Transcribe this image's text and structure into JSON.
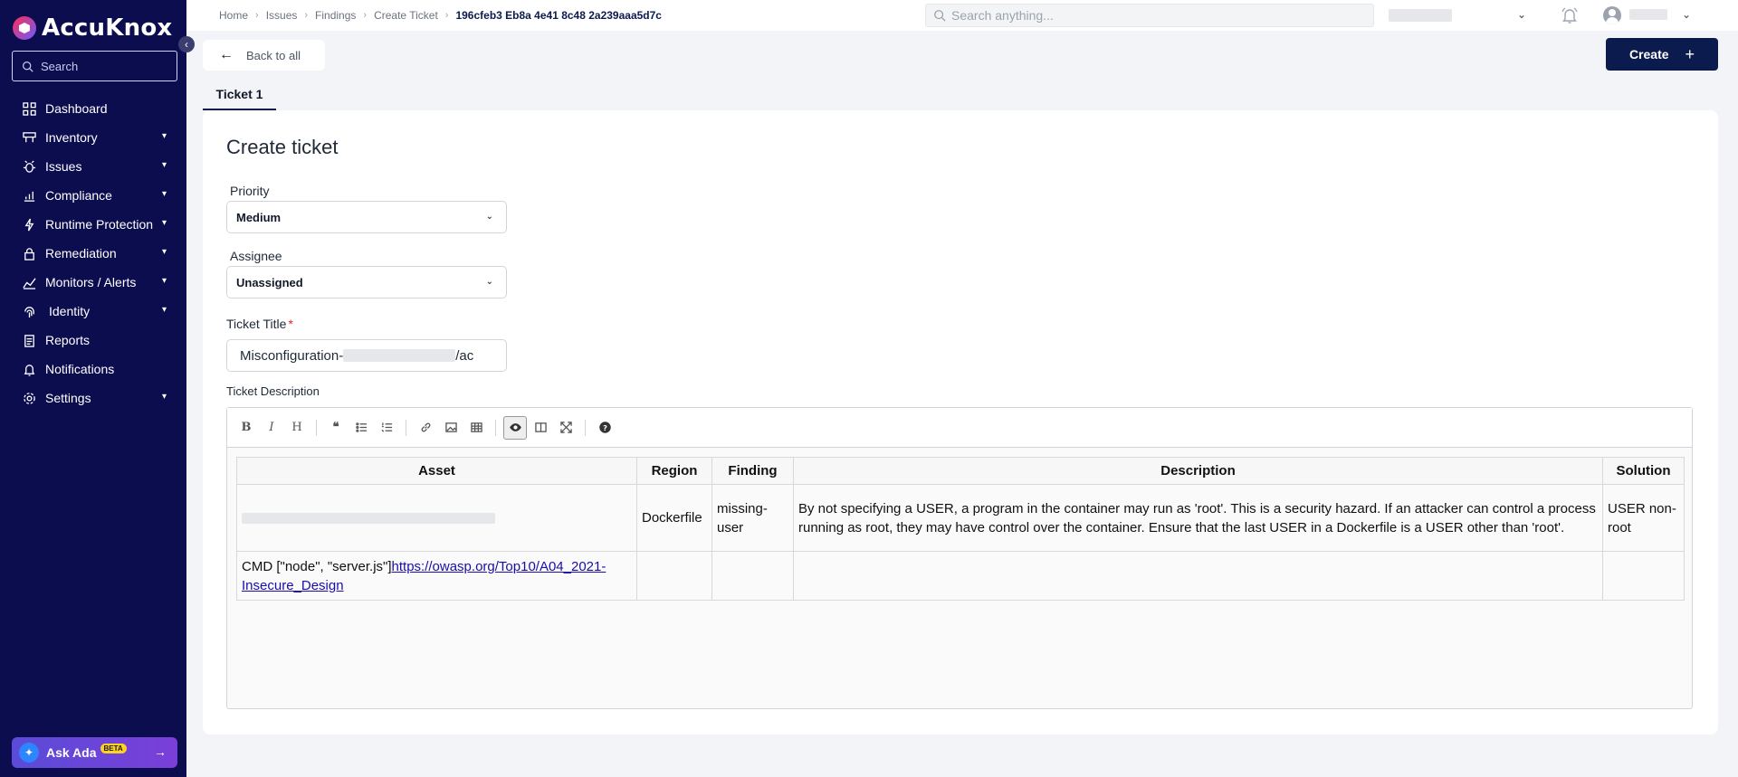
{
  "sidebar": {
    "logo": "AccuKnox",
    "search_placeholder": "Search",
    "items": [
      {
        "label": "Dashboard",
        "icon": "grid-icon",
        "expandable": false
      },
      {
        "label": "Inventory",
        "icon": "server-icon",
        "expandable": true
      },
      {
        "label": "Issues",
        "icon": "bug-icon",
        "expandable": true
      },
      {
        "label": "Compliance",
        "icon": "bar-chart-icon",
        "expandable": true
      },
      {
        "label": "Runtime Protection",
        "icon": "bolt-icon",
        "expandable": true
      },
      {
        "label": "Remediation",
        "icon": "lock-icon",
        "expandable": true
      },
      {
        "label": "Monitors / Alerts",
        "icon": "line-chart-icon",
        "expandable": true
      },
      {
        "label": "Identity",
        "icon": "fingerprint-icon",
        "expandable": true
      },
      {
        "label": "Reports",
        "icon": "clipboard-icon",
        "expandable": false
      },
      {
        "label": "Notifications",
        "icon": "bell-icon",
        "expandable": false
      },
      {
        "label": "Settings",
        "icon": "gear-icon",
        "expandable": true
      }
    ],
    "ask_ada": {
      "label": "Ask Ada",
      "badge": "BETA"
    }
  },
  "topbar": {
    "breadcrumb": [
      "Home",
      "Issues",
      "Findings",
      "Create Ticket",
      "196cfeb3 Eb8a 4e41 8c48 2a239aaa5d7c"
    ],
    "search_placeholder": "Search anything..."
  },
  "actions": {
    "back_label": "Back to all",
    "create_label": "Create"
  },
  "tabs": [
    {
      "label": "Ticket 1",
      "active": true
    }
  ],
  "form": {
    "title": "Create ticket",
    "priority": {
      "label": "Priority",
      "value": "Medium"
    },
    "assignee": {
      "label": "Assignee",
      "value": "Unassigned"
    },
    "ticket_title": {
      "label": "Ticket Title",
      "required": "*",
      "prefix": "Misconfiguration-",
      "suffix": "/ac"
    },
    "description_label": "Ticket Description"
  },
  "editor": {
    "toolbar": [
      "bold",
      "italic",
      "heading",
      "quote",
      "unordered-list",
      "ordered-list",
      "link",
      "image",
      "table",
      "preview",
      "side-by-side",
      "fullscreen",
      "guide"
    ],
    "table": {
      "headers": [
        "Asset",
        "Region",
        "Finding",
        "Description",
        "Solution"
      ],
      "rows": [
        {
          "asset": "",
          "region": "Dockerfile",
          "finding": "missing-user",
          "description": "By not specifying a USER, a program in the container may run as 'root'. This is a security hazard. If an attacker can control a process running as root, they may have control over the container. Ensure that the last USER in a Dockerfile is a USER other than 'root'.",
          "solution": "USER non-root"
        },
        {
          "asset_text": "CMD [\"node\", \"server.js\"]",
          "asset_link": "https://owasp.org/Top10/A04_2021-Insecure_Design",
          "region": "",
          "finding": "",
          "description": "",
          "solution": ""
        }
      ]
    }
  }
}
